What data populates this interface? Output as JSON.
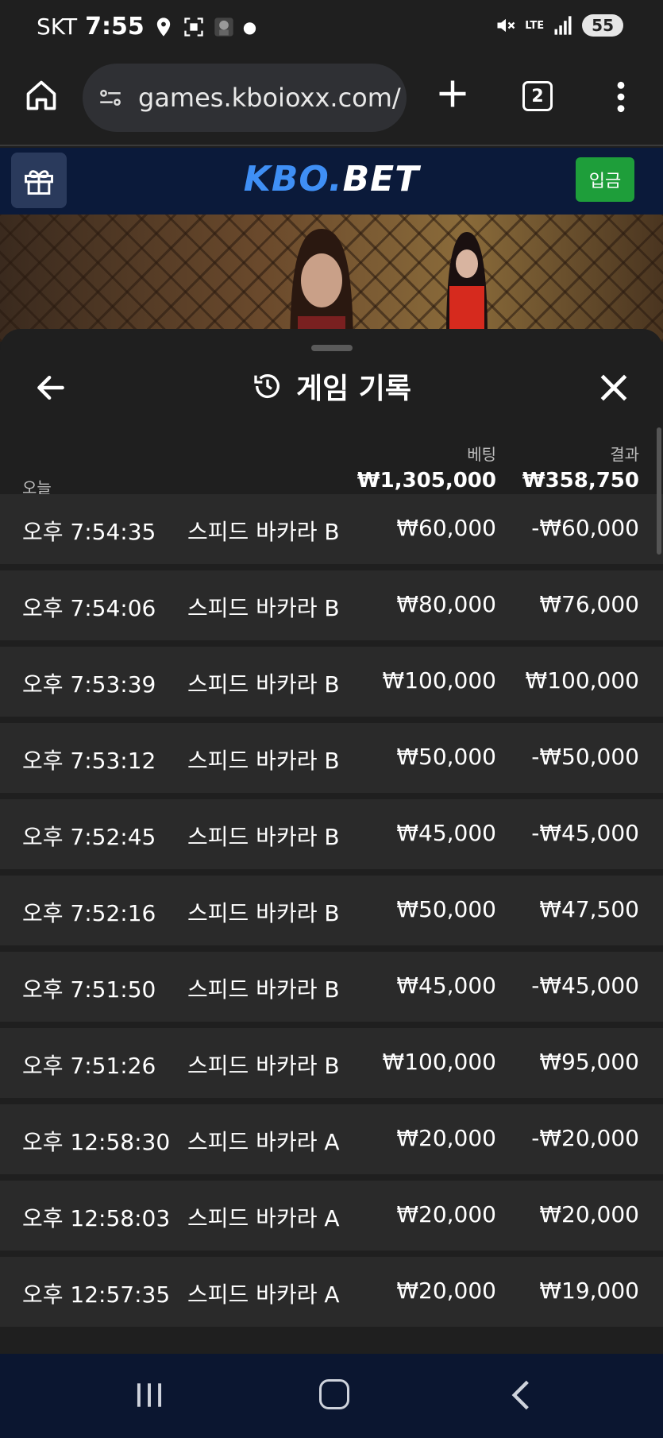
{
  "status_bar": {
    "carrier": "SKT",
    "time": "7:55",
    "network": "LTE",
    "battery": "55"
  },
  "browser": {
    "url": "games.kboioxx.com/",
    "tab_count": "2"
  },
  "site": {
    "logo_kbo": "KBO",
    "logo_dot": ".",
    "logo_bet": "BET",
    "deposit_label": "입금"
  },
  "panel": {
    "title": "게임 기록",
    "today_label": "오늘",
    "bet_header": "베팅",
    "result_header": "결과",
    "total_bet": "₩1,305,000",
    "total_result": "₩358,750"
  },
  "history": [
    {
      "time": "오후 7:54:35",
      "game": "스피드 바카라 B",
      "bet": "₩60,000",
      "result": "-₩60,000"
    },
    {
      "time": "오후 7:54:06",
      "game": "스피드 바카라 B",
      "bet": "₩80,000",
      "result": "₩76,000"
    },
    {
      "time": "오후 7:53:39",
      "game": "스피드 바카라 B",
      "bet": "₩100,000",
      "result": "₩100,000"
    },
    {
      "time": "오후 7:53:12",
      "game": "스피드 바카라 B",
      "bet": "₩50,000",
      "result": "-₩50,000"
    },
    {
      "time": "오후 7:52:45",
      "game": "스피드 바카라 B",
      "bet": "₩45,000",
      "result": "-₩45,000"
    },
    {
      "time": "오후 7:52:16",
      "game": "스피드 바카라 B",
      "bet": "₩50,000",
      "result": "₩47,500"
    },
    {
      "time": "오후 7:51:50",
      "game": "스피드 바카라 B",
      "bet": "₩45,000",
      "result": "-₩45,000"
    },
    {
      "time": "오후 7:51:26",
      "game": "스피드 바카라 B",
      "bet": "₩100,000",
      "result": "₩95,000"
    },
    {
      "time": "오후 12:58:30",
      "game": "스피드 바카라 A",
      "bet": "₩20,000",
      "result": "-₩20,000"
    },
    {
      "time": "오후 12:58:03",
      "game": "스피드 바카라 A",
      "bet": "₩20,000",
      "result": "₩20,000"
    },
    {
      "time": "오후 12:57:35",
      "game": "스피드 바카라 A",
      "bet": "₩20,000",
      "result": "₩19,000"
    }
  ],
  "colors": {
    "site_header_bg": "#0b1a3a",
    "logo_accent": "#3f8ff5",
    "deposit_green": "#1e9e3a",
    "row_bg": "#2a2a2a",
    "panel_bg": "#1f1f1f"
  },
  "icons": {
    "home": "home-icon",
    "site_settings": "tune-icon",
    "new_tab": "plus-icon",
    "menu": "more-vert-icon",
    "gift": "gift-icon",
    "back": "arrow-left-icon",
    "history": "history-icon",
    "close": "close-icon"
  }
}
